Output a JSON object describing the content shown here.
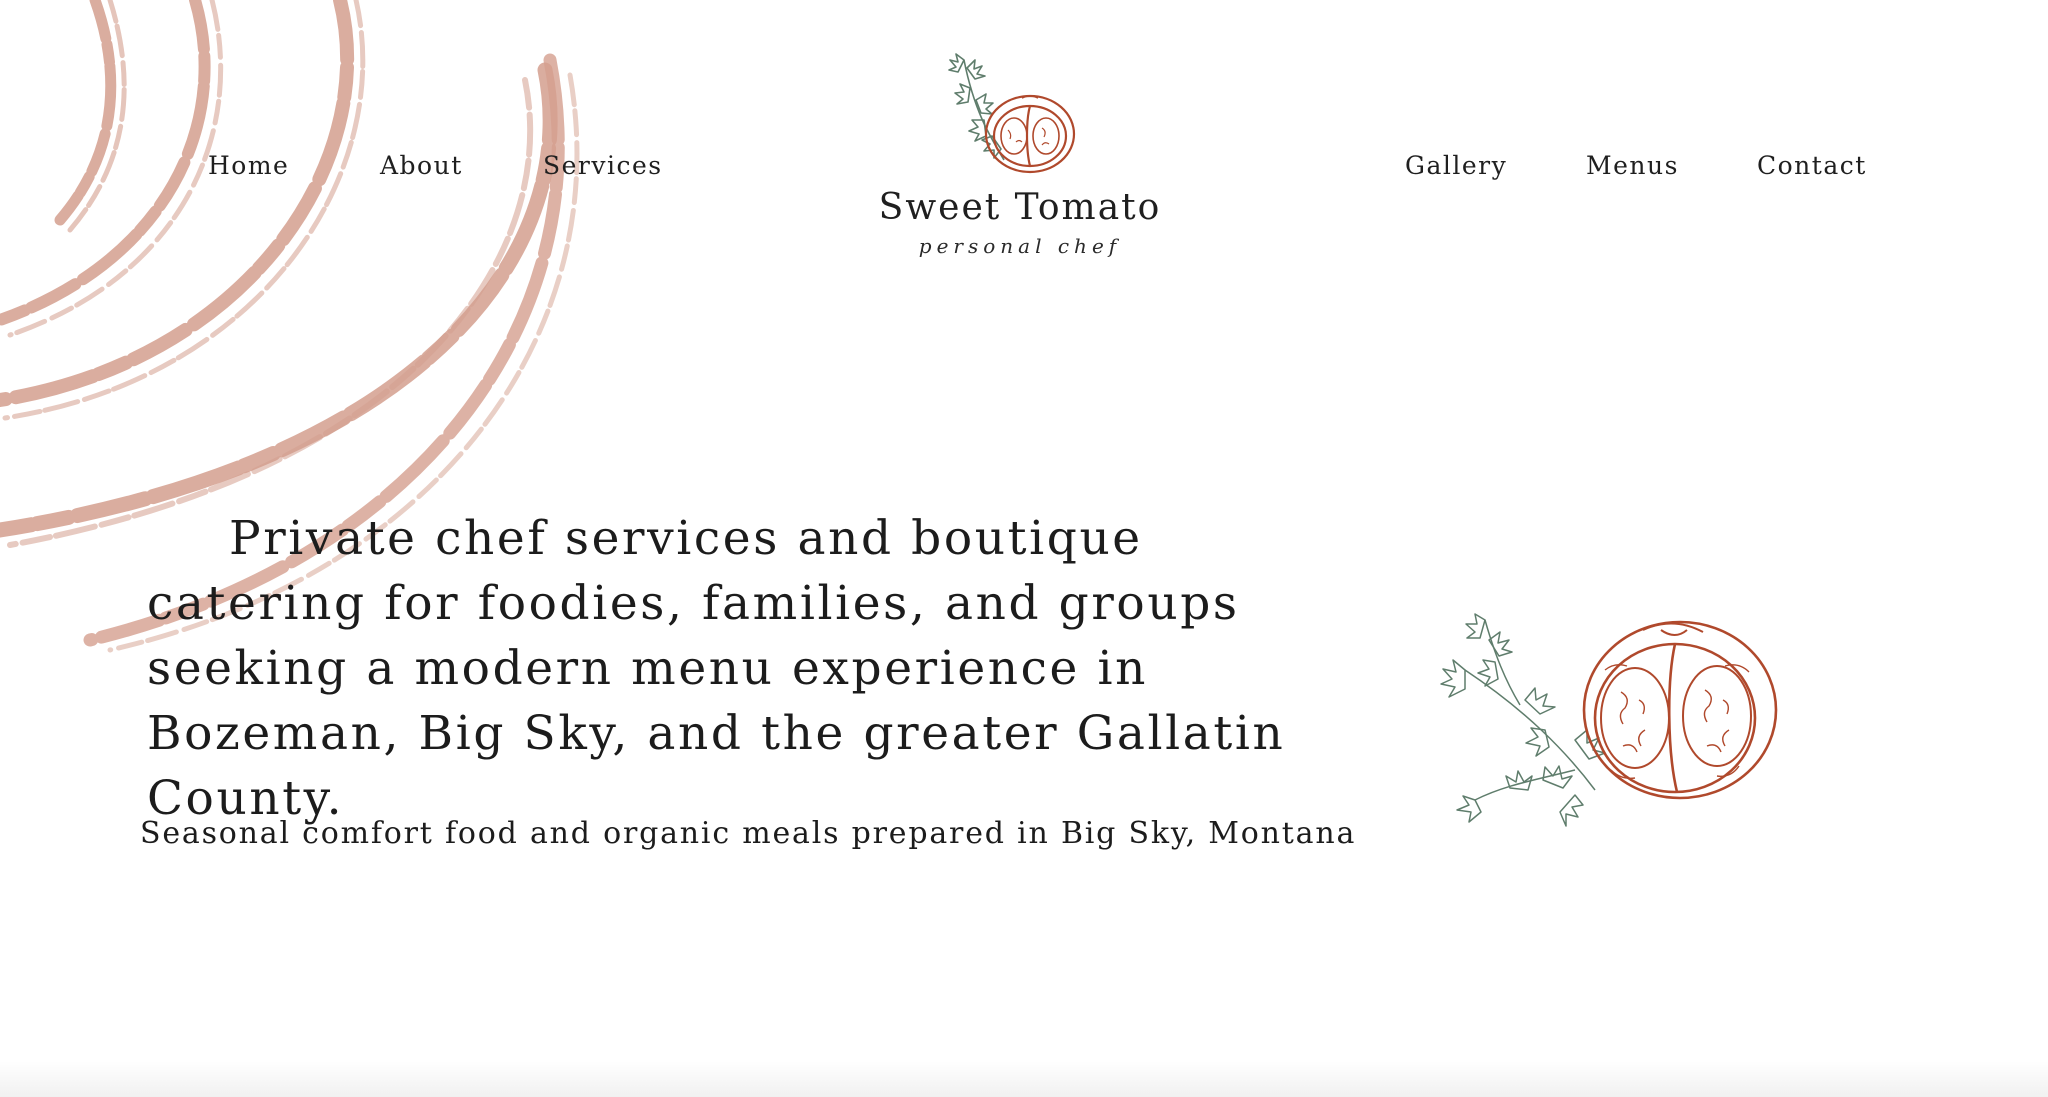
{
  "brand": {
    "name": "Sweet Tomato",
    "tagline": "personal chef",
    "logo_icon": "tomato-parsley-icon",
    "accent_color": "#b0492c",
    "leaf_color": "#5f7d6c",
    "brush_color": "#d49f8e"
  },
  "nav": {
    "left": [
      {
        "label": "Home"
      },
      {
        "label": "About"
      },
      {
        "label": "Services"
      }
    ],
    "right": [
      {
        "label": "Gallery"
      },
      {
        "label": "Menus"
      },
      {
        "label": "Contact"
      }
    ]
  },
  "hero": {
    "headline": "Private chef services and boutique catering for foodies, families, and groups seeking a modern menu experience in  Bozeman, Big Sky, and the greater Gallatin County.",
    "subheadline": "Seasonal comfort food and organic meals prepared in Big Sky, Montana",
    "illustration_icon": "tomato-half-illustration"
  }
}
